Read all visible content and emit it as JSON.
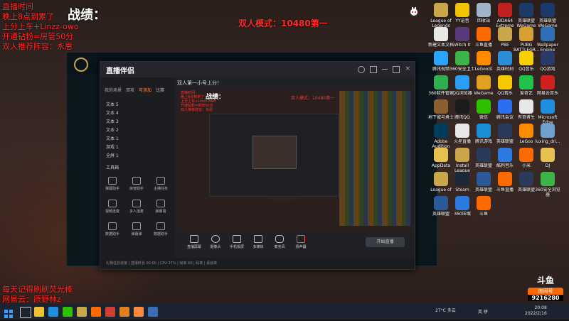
{
  "overlay": {
    "title_lines": [
      "直播时间",
      "晚上8点到累了",
      "上分上车+Linzz-owo",
      "开通钻粉=房管50分",
      "双人推荐阵容：永恩"
    ],
    "zhanji": "战绩：",
    "mode_text": "双人模式：10480第一",
    "bottom_lines": [
      "每天记得刷刷荧光棒",
      "网易云：原野林z"
    ]
  },
  "zhibo_app": {
    "logo": "直播伴侣",
    "stream_title": "双人第一小号上分！",
    "side_tabs": [
      "我的场景",
      "双攻",
      "可添加",
      "比赛"
    ],
    "layers": [
      "文本 5",
      "文本 4",
      "文本 3",
      "文本 2",
      "文本 1",
      "游戏 1",
      "全屏 1"
    ],
    "tools_header": "工具箱",
    "tools": [
      "弹幕助手",
      "房管助手",
      "主播任务",
      "视频连麦",
      "多人连麦",
      "弹幕墙",
      "数据助手",
      "弹幕弹",
      "数据助手"
    ],
    "bottom_buttons": [
      "直播屏幕",
      "摄像头",
      "手机投屏",
      "多媒体",
      "麦克风",
      "扬声器"
    ],
    "start_label": "开始直播",
    "status_text": "礼物任务进度 | 直播时长 00:00 | CPU 27% | 帧率 60 | 码率 | 丢帧率"
  },
  "desktop_icons": [
    {
      "label": "League of Legends",
      "color": "#c9a64a"
    },
    {
      "label": "YY语音",
      "color": "#f2c300"
    },
    {
      "label": "回收站",
      "color": "#9fb4c8"
    },
    {
      "label": "AIDA64 Extreme",
      "color": "#c02020"
    },
    {
      "label": "英雄联盟WeGame",
      "color": "#1b3a6a"
    },
    {
      "label": "英雄联盟WeGame",
      "color": "#1b3a6a"
    },
    {
      "label": "新建文本文档",
      "color": "#e8e8e8"
    },
    {
      "label": "Witch It",
      "color": "#5a3a7a"
    },
    {
      "label": "斗鱼直播",
      "color": "#ff6a00"
    },
    {
      "label": "PBE",
      "color": "#c9a64a"
    },
    {
      "label": "PUBG BATTLEGR...",
      "color": "#d8a030"
    },
    {
      "label": "Wallpaper Engine",
      "color": "#2e6fb8"
    },
    {
      "label": "腾讯视频",
      "color": "#2aa3ff"
    },
    {
      "label": "360安全卫士",
      "color": "#3bb54a"
    },
    {
      "label": "LeGoo拉",
      "color": "#ff8a00"
    },
    {
      "label": "英雄时刻",
      "color": "#2a8fd8"
    },
    {
      "label": "QQ音乐",
      "color": "#f7d000"
    },
    {
      "label": "QQ游戏",
      "color": "#2a3a6a"
    },
    {
      "label": "360软件管家",
      "color": "#2fb050"
    },
    {
      "label": "QQ浏览器",
      "color": "#2a9df4"
    },
    {
      "label": "WeGame",
      "color": "#e0a020"
    },
    {
      "label": "QQ音乐",
      "color": "#f5c800"
    },
    {
      "label": "爱奇艺",
      "color": "#1fc24a"
    },
    {
      "label": "网易云音乐",
      "color": "#d02020"
    },
    {
      "label": "地下城与勇士",
      "color": "#8a6030"
    },
    {
      "label": "腾讯QQ",
      "color": "#1c1c1c"
    },
    {
      "label": "微信",
      "color": "#2dc100"
    },
    {
      "label": "腾讯会议",
      "color": "#2a6ff0"
    },
    {
      "label": "有奇者生",
      "color": "#e8e8e8"
    },
    {
      "label": "Microsoft Edge",
      "color": "#1f8fe0"
    },
    {
      "label": "Adobe Audition",
      "color": "#003d5a"
    },
    {
      "label": "火星直播",
      "color": "#e8e8e8"
    },
    {
      "label": "腾讯游戏",
      "color": "#1a8fd8"
    },
    {
      "label": "英雄联盟",
      "color": "#2a3a5a"
    },
    {
      "label": "LeGoo",
      "color": "#ff8a00"
    },
    {
      "label": "luxing_dri...",
      "color": "#6fa0d0"
    },
    {
      "label": "AppData",
      "color": "#e8c050"
    },
    {
      "label": "Install League",
      "color": "#c9a64a"
    },
    {
      "label": "英雄联盟",
      "color": "#2a3a5a"
    },
    {
      "label": "酷狗音乐",
      "color": "#2a7ae0"
    },
    {
      "label": "小米",
      "color": "#ff6a00"
    },
    {
      "label": "DJ",
      "color": "#e8c050"
    },
    {
      "label": "League of",
      "color": "#c9a64a"
    },
    {
      "label": "Steam",
      "color": "#1b2838"
    },
    {
      "label": "英雄联盟",
      "color": "#2a5a9a"
    },
    {
      "label": "斗鱼直播",
      "color": "#ff6a00"
    },
    {
      "label": "英雄联盟",
      "color": "#2a3a5a"
    },
    {
      "label": "360安全浏览器",
      "color": "#3bb54a"
    },
    {
      "label": "英雄联盟",
      "color": "#2a5a9a"
    },
    {
      "label": "360压缩",
      "color": "#2a7ae0"
    },
    {
      "label": "斗鱼",
      "color": "#ff6a00"
    }
  ],
  "douyu": {
    "logo": "斗鱼",
    "room_label": "房间号",
    "room_number": "9216280"
  },
  "taskbar": {
    "weather": "27°C 多云",
    "time": "20:08",
    "date": "2022/2/16",
    "tray": "英 拼"
  }
}
